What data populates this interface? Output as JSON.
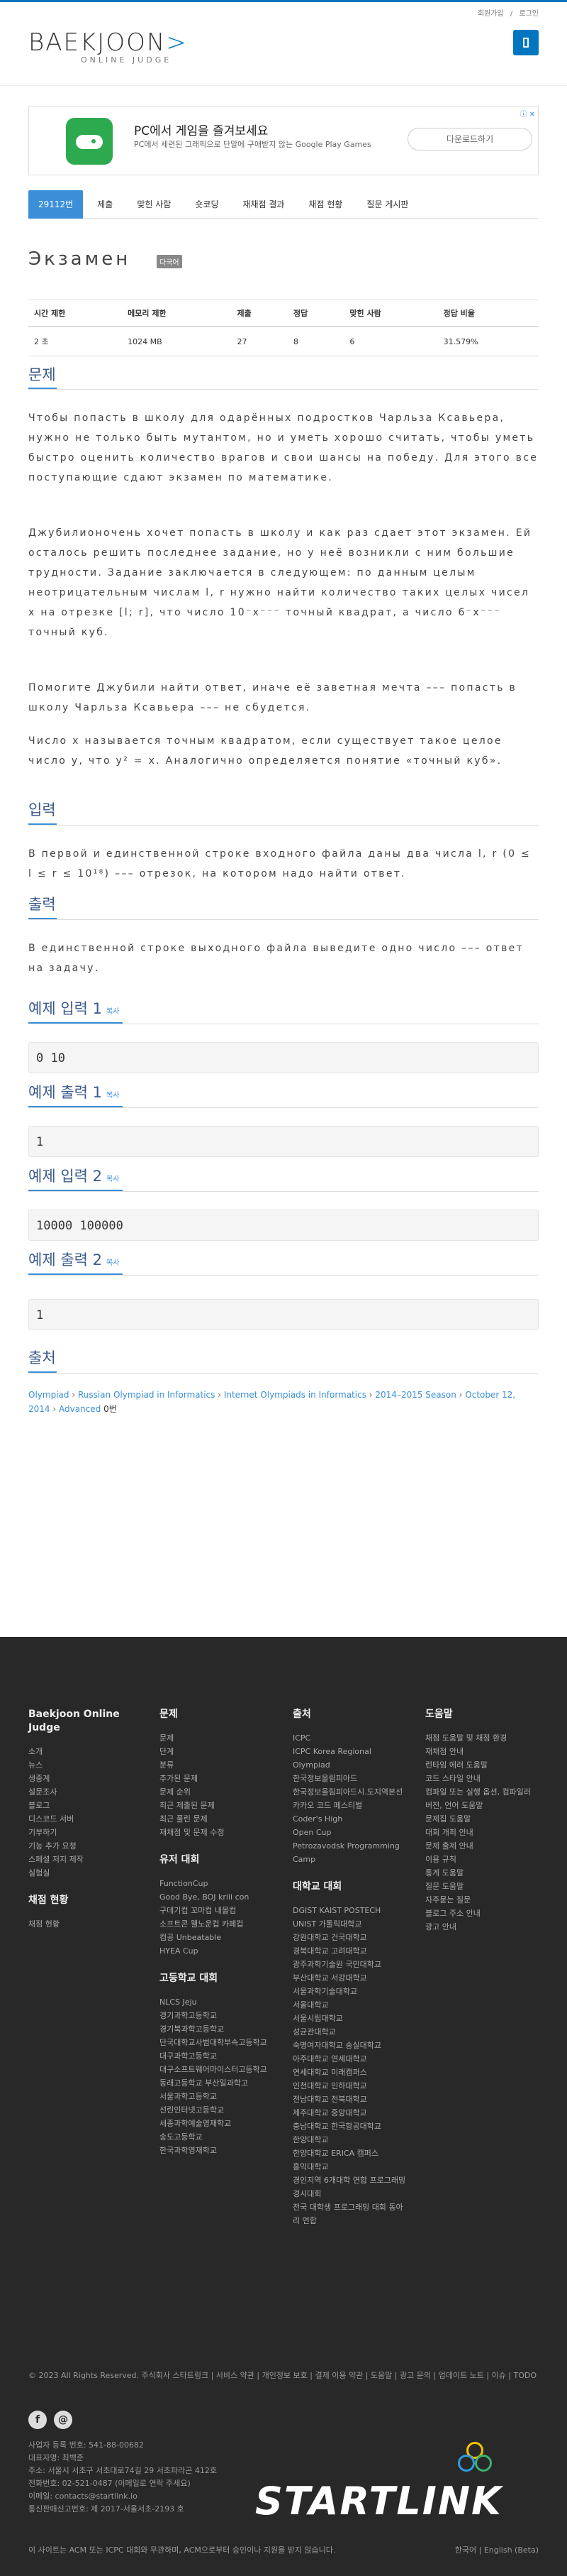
{
  "header": {
    "util_links": [
      "회원가입",
      "로그인"
    ],
    "logo_main_prefix": "BAEKJOON",
    "logo_main_suffix": ">",
    "logo_sub": "ONLINE JUDGE"
  },
  "ad": {
    "title": "PC에서 게임을 즐겨보세요",
    "description": "PC에서 세련된 그래픽으로 단말에 구애받지 않는 Google Play Games",
    "cta": "다운로드하기",
    "corner": "ⓘ ✕"
  },
  "tabs": [
    "29112번",
    "제출",
    "맞힌 사람",
    "숏코딩",
    "재채점 결과",
    "채점 현황",
    "질문 게시판"
  ],
  "problem": {
    "title": "Экзамен",
    "badge": "다국어",
    "table": {
      "headers": [
        "시간 제한",
        "메모리 제한",
        "제출",
        "정답",
        "맞힌 사람",
        "정답 비율"
      ],
      "values": [
        "2 초",
        "1024 MB",
        "27",
        "8",
        "6",
        "31.579%"
      ]
    },
    "sections": {
      "statement_title": "문제",
      "statement_p1": "Чтобы попасть в школу для одарённых подростков Чарльза Ксавьера, нужно не только быть мутантом, но и уметь хорошо считать, чтобы уметь быстро оценить количество врагов и свои шансы на победу. Для этого все поступающие сдают экзамен по математике.",
      "statement_p2": "Джубилионочень хочет попасть в школу и как раз сдает этот экзамен. Ей осталось решить последнее задание, но у неё возникли с ним большие трудности. Задание заключается в следующем: по данным целым неотрицательным числам l, r нужно найти количество таких целых чисел x на отрезке [l; r], что число 10⁻x⁻⁻⁻ точный квадрат, а число 6⁻x⁻⁻⁻ точный куб.",
      "statement_p3": "Помогите Джубили найти ответ, иначе её заветная мечта ––– попасть в школу Чарльза Ксавьера ––– не сбудется.",
      "statement_p4": "Число x называется точным квадратом, если существует такое целое число y, что y² = x. Аналогично определяется понятие «точный куб».",
      "input_title": "입력",
      "input_text": "В первой и единственной строке входного файла даны два числа l, r (0 ≤ l ≤ r ≤ 10¹⁸) ––– отрезок, на котором надо найти ответ.",
      "output_title": "출력",
      "output_text": "В единственной строке выходного файла выведите одно число ––– ответ на задачу.",
      "sample_input_1_title": "예제 입력 1",
      "sample_output_1_title": "예제 출력 1",
      "sample_input_2_title": "예제 입력 2",
      "sample_output_2_title": "예제 출력 2",
      "copy_label": "복사",
      "sample_input_1": "0 10",
      "sample_output_1": "1",
      "sample_input_2": "10000 100000",
      "sample_output_2": "1",
      "source_title": "출처"
    },
    "source": {
      "crumbs": [
        "Olympiad",
        "Russian Olympiad in Informatics",
        "Internet Olympiads in Informatics",
        "2014–2015 Season",
        "October 12, 2014",
        "Advanced"
      ],
      "suffix": "0번"
    }
  },
  "footer": {
    "col1_title": "Baekjoon Online Judge",
    "col1_items": [
      "소개",
      "뉴스",
      "생중계",
      "설문조사",
      "블로그",
      "디스코드 서버",
      "기부하기",
      "기능 추가 요청",
      "스페셜 저지 제작",
      "실험실"
    ],
    "col1b_title": "채점 현황",
    "col1b_items": [
      "채점 현황"
    ],
    "col2_title": "문제",
    "col2_items": [
      "문제",
      "단계",
      "분류",
      "추가된 문제",
      "문제 순위",
      "최근 제출된 문제",
      "최근 풀린 문제",
      "재채점 및 문제 수정"
    ],
    "col2b_title": "유저 대회",
    "col2b_items": [
      "FunctionCup",
      "Good Bye, BOJ kriii con",
      "구데기컵 꼬마컵 내몰컵",
      "소프트콘 웰노운컵 카페컵",
      "컴공 Unbeatable",
      "HYEA Cup"
    ],
    "col2c_title": "고등학교 대회",
    "col2c_items": [
      "NLCS Jeju",
      "경기과학고등학교",
      "경기북과학고등학교",
      "단국대학교사범대학부속고등학교",
      "대구과학고등학교",
      "대구소프트웨어마이스터고등학교",
      "동래고등학교 부산일과학고",
      "서울과학고등학교",
      "선린인터넷고등학교",
      "세종과학예술영재학교",
      "송도고등학교",
      "한국과학영재학교"
    ],
    "col3_title": "출처",
    "col3_items": [
      "ICPC",
      "ICPC Korea Regional",
      "Olympiad",
      "한국정보올림피아드",
      "한국정보올림피아드시.도지역본선",
      "카카오 코드 페스티벌",
      "Coder's High",
      "Open Cup",
      "Petrozavodsk Programming Camp"
    ],
    "col3b_title": "대학교 대회",
    "col3b_items": [
      "DGIST KAIST POSTECH UNIST 가톨릭대학교",
      "강원대학교 건국대학교",
      "경북대학교 고려대학교",
      "광주과학기술원 국민대학교",
      "부산대학교 서강대학교",
      "서울과학기술대학교",
      "서울대학교",
      "서울시립대학교",
      "성균관대학교",
      "숙명여자대학교 숭실대학교",
      "아주대학교 연세대학교",
      "연세대학교 미래캠퍼스",
      "인천대학교 인하대학교",
      "전남대학교 전북대학교",
      "제주대학교 중앙대학교",
      "충남대학교 한국항공대학교",
      "한양대학교",
      "한양대학교 ERICA 캠퍼스",
      "홍익대학교",
      "경인지역 6개대학 연합 프로그래밍 경시대회",
      "전국 대학생 프로그래밍 대회 동아리 연합"
    ],
    "col4_title": "도움말",
    "col4_items": [
      "채점 도움말 및 채점 환경",
      "재채점 안내",
      "런타임 에러 도움말",
      "코드 스타일 안내",
      "컴파일 또는 실행 옵션, 컴파일러 버전, 언어 도움말",
      "문제집 도움말",
      "대회 개최 안내",
      "문제 출제 안내",
      "이용 규칙",
      "통계 도움말",
      "질문 도움말",
      "자주묻는 질문",
      "블로그 주소 안내",
      "광고 안내"
    ],
    "links_line": "© 2023 All Rights Reserved. 주식회사 스타트링크 | 서비스 약관 | 개인정보 보호 | 결제 이용 약관 | 도움말 | 광고 문의 | 업데이트 노트 | 이슈 | TODO",
    "company_lines": [
      "사업자 등록 번호: 541-88-00682",
      "대표자명: 최백준",
      "주소: 서울시 서초구 서초대로74길 29 서초파라곤 412호",
      "전화번호: 02-521-0487 (이메일로 연락 주세요)",
      "이메일: contacts@startlink.io",
      "통신판매신고번호: 제 2017-서울서초-2193 호"
    ],
    "disclaimer": "이 사이트는 ACM 또는 ICPC 대회와 무관하며, ACM으로부터 승인이나 지원을 받지 않습니다.",
    "lang": "한국어 | English (Beta)",
    "brand": "STARTLINK",
    "social": [
      "f",
      "@"
    ]
  }
}
